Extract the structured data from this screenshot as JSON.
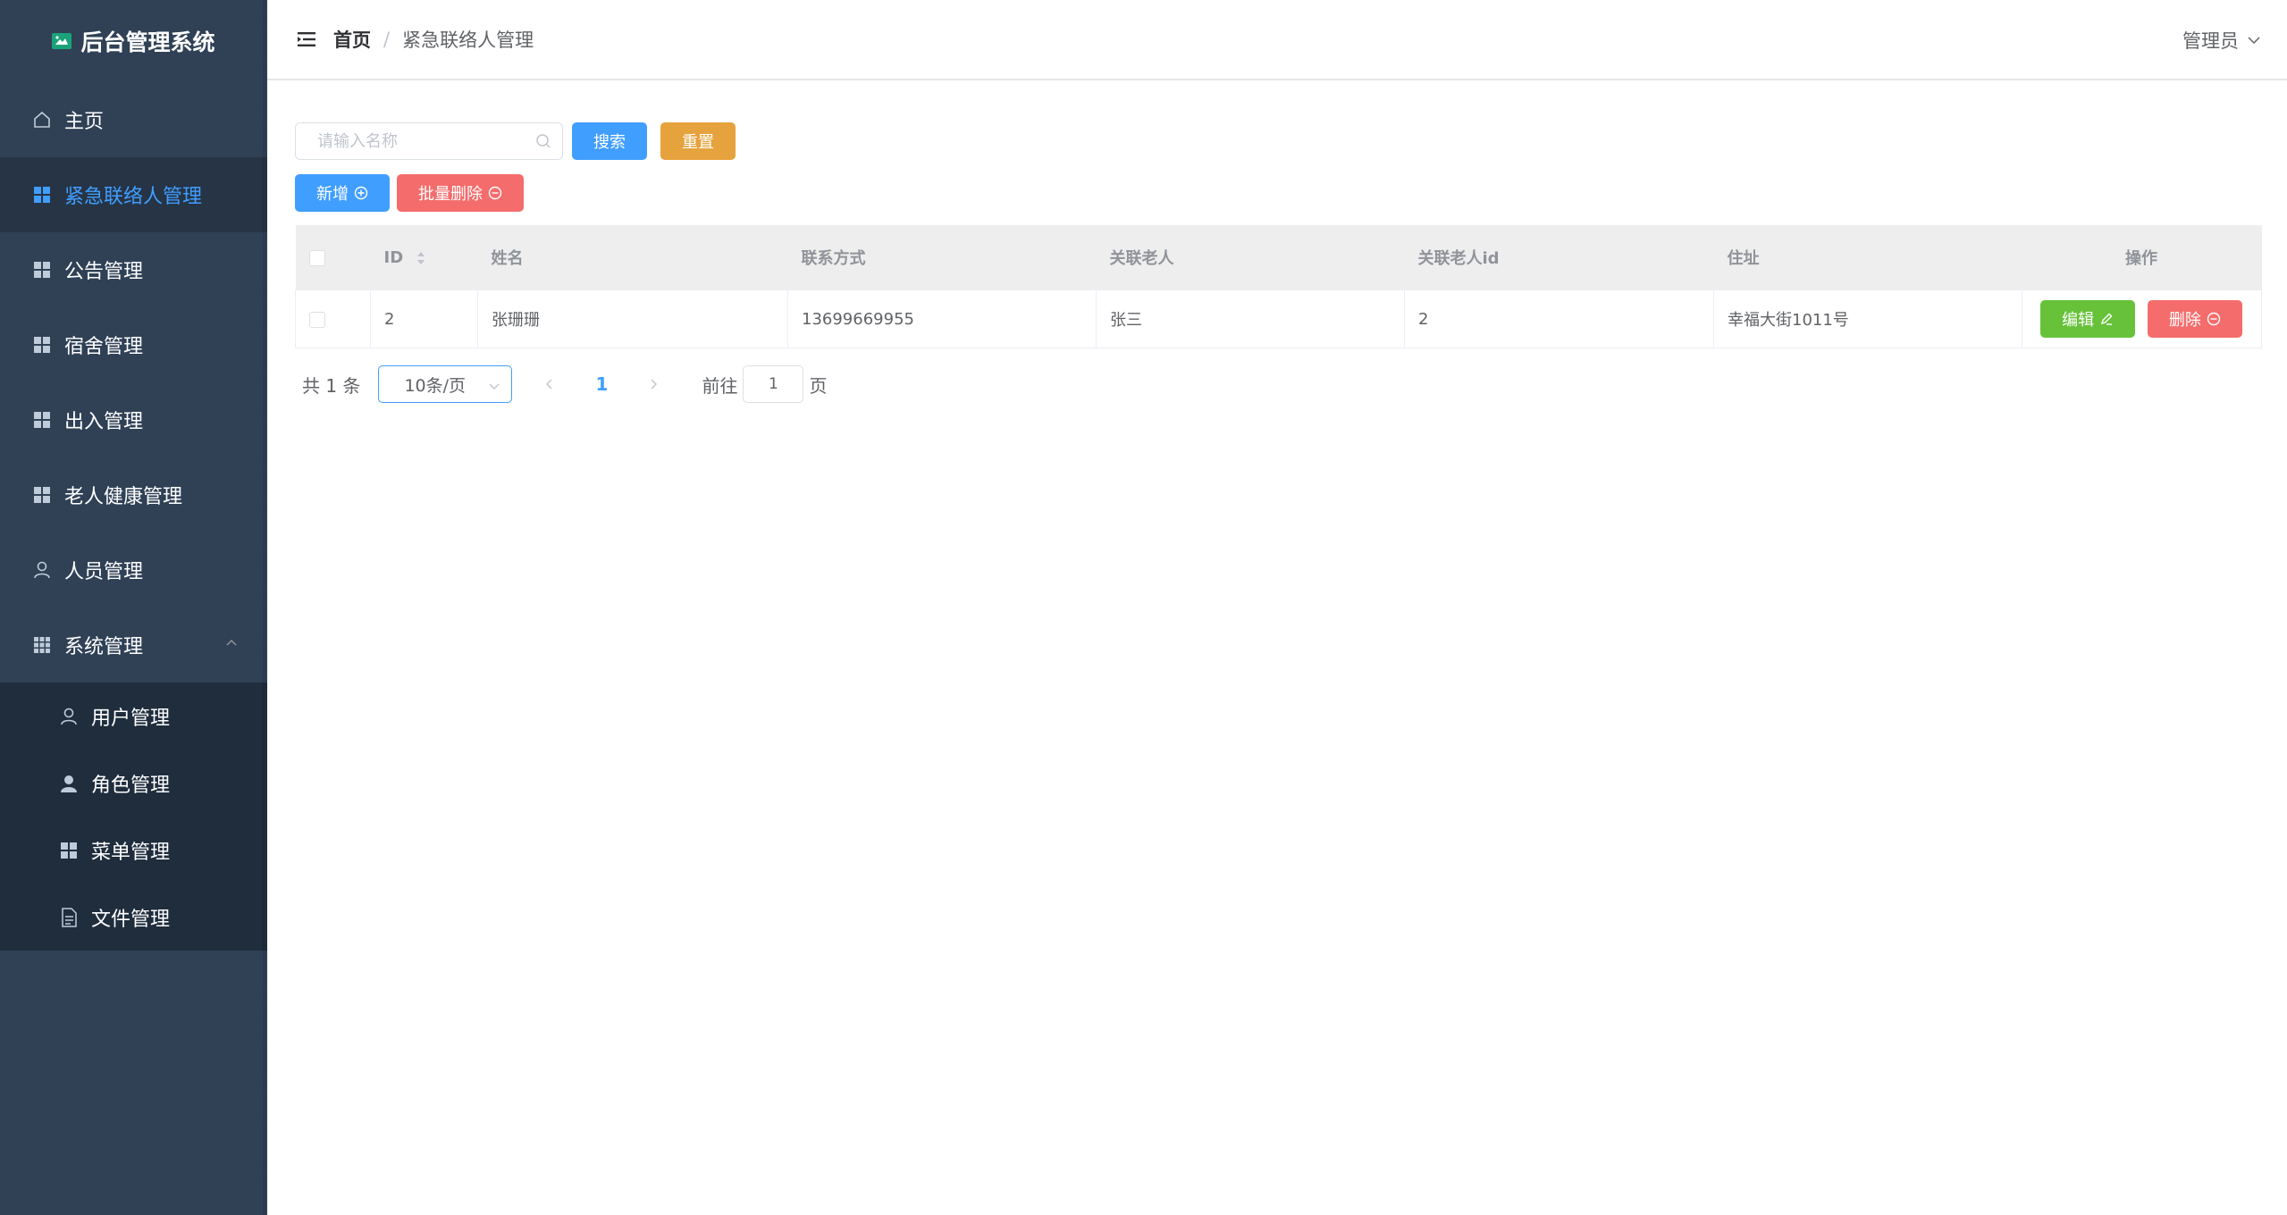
{
  "app": {
    "title": "后台管理系统"
  },
  "sidebar": {
    "items": [
      {
        "label": "主页",
        "icon": "home-icon"
      },
      {
        "label": "紧急联络人管理",
        "icon": "grid-icon",
        "active": true
      },
      {
        "label": "公告管理",
        "icon": "grid-icon"
      },
      {
        "label": "宿舍管理",
        "icon": "grid-icon"
      },
      {
        "label": "出入管理",
        "icon": "grid-icon"
      },
      {
        "label": "老人健康管理",
        "icon": "grid-icon"
      },
      {
        "label": "人员管理",
        "icon": "user-icon"
      }
    ],
    "system": {
      "label": "系统管理",
      "icon": "apps-icon",
      "expanded": true,
      "children": [
        {
          "label": "用户管理",
          "icon": "user-icon"
        },
        {
          "label": "角色管理",
          "icon": "user-solid-icon"
        },
        {
          "label": "菜单管理",
          "icon": "grid-icon"
        },
        {
          "label": "文件管理",
          "icon": "document-icon"
        }
      ]
    }
  },
  "header": {
    "breadcrumb": {
      "home": "首页",
      "separator": "/",
      "current": "紧急联络人管理"
    },
    "user": "管理员"
  },
  "toolbar": {
    "search_placeholder": "请输入名称",
    "search_value": "",
    "search_label": "搜索",
    "reset_label": "重置",
    "add_label": "新增",
    "batch_delete_label": "批量删除"
  },
  "table": {
    "columns": [
      "ID",
      "姓名",
      "联系方式",
      "关联老人",
      "关联老人id",
      "住址",
      "操作"
    ],
    "rows": [
      {
        "id": "2",
        "name": "张珊珊",
        "phone": "13699669955",
        "elder": "张三",
        "elder_id": "2",
        "address": "幸福大街1011号"
      }
    ],
    "edit_label": "编辑",
    "delete_label": "删除"
  },
  "pagination": {
    "total_text": "共 1 条",
    "page_size": "10条/页",
    "current_page": "1",
    "goto_prefix": "前往",
    "goto_value": "1",
    "goto_suffix": "页"
  },
  "colors": {
    "sidebar_bg": "#304156",
    "sidebar_active_bg": "#263445",
    "submenu_bg": "#1f2d3d",
    "primary": "#409eff",
    "warning": "#e6a23c",
    "danger": "#f56c6c",
    "success": "#67c23a"
  }
}
